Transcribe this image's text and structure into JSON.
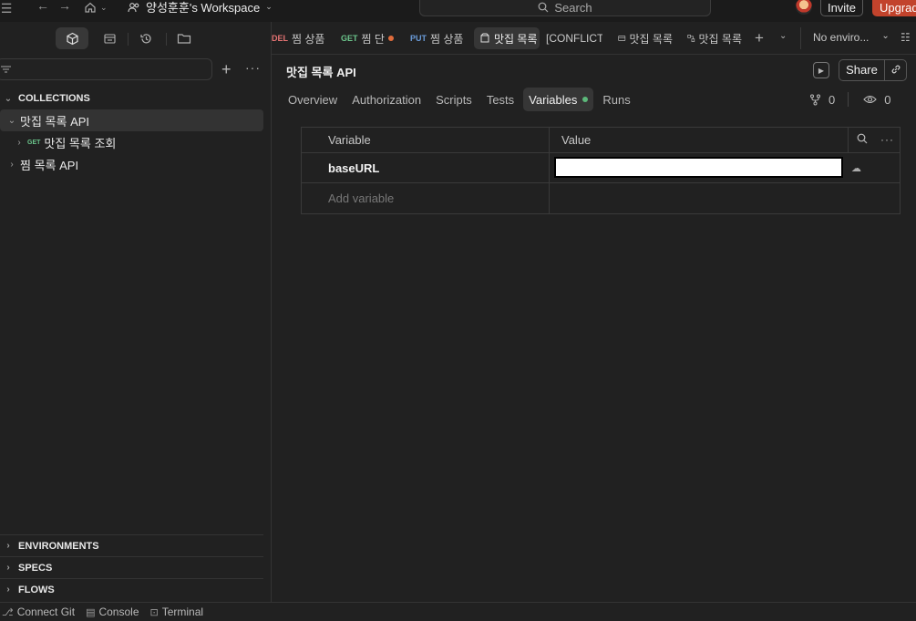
{
  "topbar": {
    "workspace_name": "양성훈훈's Workspace",
    "search_placeholder": "Search",
    "invite_label": "Invite",
    "upgrade_label": "Upgrade"
  },
  "sidebar": {
    "sections": {
      "collections": "COLLECTIONS",
      "environments": "ENVIRONMENTS",
      "specs": "SPECS",
      "flows": "FLOWS"
    },
    "tree": [
      {
        "label": "맛집 목록 API",
        "expanded": true
      },
      {
        "method": "GET",
        "label": "맛집 목록 조회"
      },
      {
        "label": "찜 목록 API",
        "expanded": false
      }
    ]
  },
  "tabs": [
    {
      "method": "DEL",
      "label": "찜 상품"
    },
    {
      "method": "GET",
      "label": "찜 단"
    },
    {
      "method": "PUT",
      "label": "찜 상품"
    },
    {
      "label": "맛집 목록"
    },
    {
      "label": "[CONFLICT"
    },
    {
      "label": "맛집 목록"
    },
    {
      "label": "맛집 목록"
    }
  ],
  "environment": {
    "selected": "No enviro..."
  },
  "page": {
    "title": "맛집 목록 API",
    "share_label": "Share",
    "subtabs": [
      "Overview",
      "Authorization",
      "Scripts",
      "Tests",
      "Variables",
      "Runs"
    ],
    "forks_count": "0",
    "watchers_count": "0"
  },
  "variables_table": {
    "headers": {
      "variable": "Variable",
      "value": "Value"
    },
    "rows": [
      {
        "key": "baseURL",
        "value": ""
      }
    ],
    "add_placeholder": "Add variable"
  },
  "statusbar": {
    "connect_git": "Connect Git",
    "console": "Console",
    "terminal": "Terminal"
  }
}
